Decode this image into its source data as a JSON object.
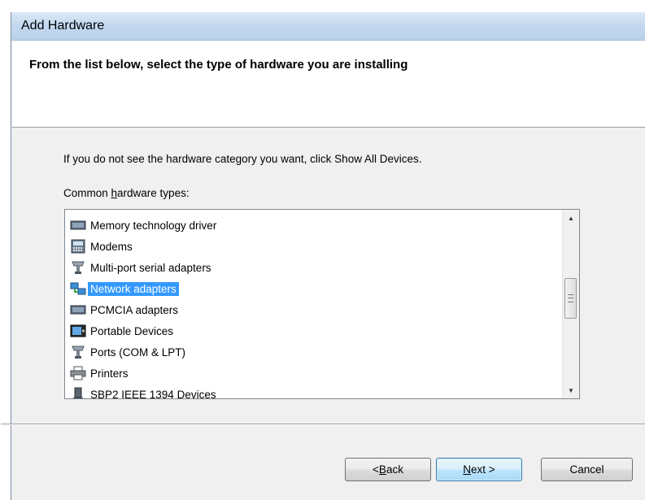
{
  "window": {
    "title": "Add Hardware"
  },
  "header": {
    "title": "From the list below, select the type of hardware you are installing"
  },
  "instruction": "If you do not see the hardware category you want, click Show All Devices.",
  "list": {
    "label_before": "Common ",
    "label_mnemonic": "h",
    "label_after": "ardware types:",
    "items": [
      {
        "label": "Memory technology driver",
        "icon": "memory-card-icon",
        "selected": false
      },
      {
        "label": "Modems",
        "icon": "modem-icon",
        "selected": false
      },
      {
        "label": "Multi-port serial adapters",
        "icon": "serial-connector-icon",
        "selected": false
      },
      {
        "label": "Network adapters",
        "icon": "network-adapter-icon",
        "selected": true
      },
      {
        "label": "PCMCIA adapters",
        "icon": "pcmcia-card-icon",
        "selected": false
      },
      {
        "label": "Portable Devices",
        "icon": "portable-device-icon",
        "selected": false
      },
      {
        "label": "Ports (COM & LPT)",
        "icon": "port-connector-icon",
        "selected": false
      },
      {
        "label": "Printers",
        "icon": "printer-icon",
        "selected": false
      },
      {
        "label": "SBP2 IEEE 1394 Devices",
        "icon": "firewire-device-icon",
        "selected": false
      }
    ]
  },
  "buttons": {
    "back_prefix": "< ",
    "back_mnemonic": "B",
    "back_rest": "ack",
    "next_mnemonic": "N",
    "next_rest": "ext >",
    "cancel": "Cancel"
  },
  "colors": {
    "selection": "#3399ff",
    "titlebar": "#c4d9ef",
    "dialog_bg": "#f0f0f0"
  }
}
